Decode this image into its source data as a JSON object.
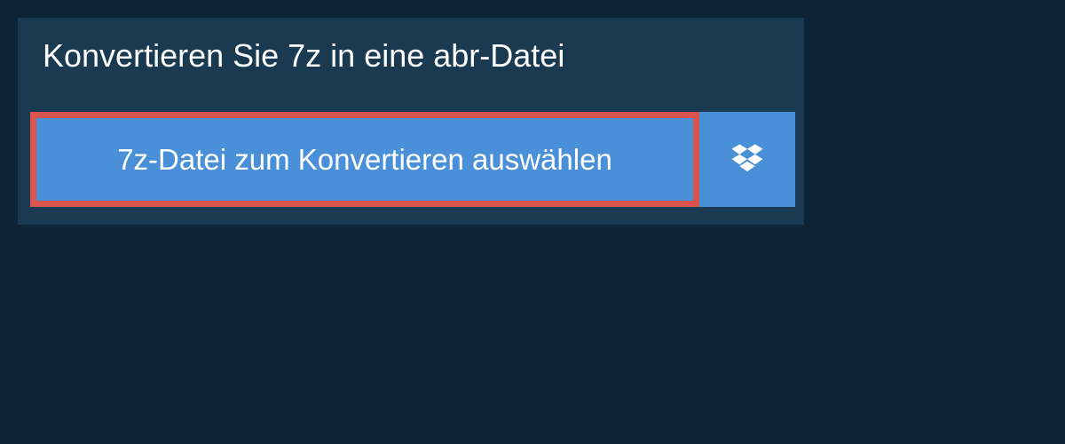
{
  "heading": "Konvertieren Sie 7z in eine abr-Datei",
  "buttons": {
    "select_file": "7z-Datei zum Konvertieren auswählen",
    "dropbox": "dropbox"
  },
  "colors": {
    "background": "#0d2437",
    "panel": "#1a3a52",
    "button": "#4a90d9",
    "highlight_border": "#d9534f",
    "text": "#ffffff"
  }
}
